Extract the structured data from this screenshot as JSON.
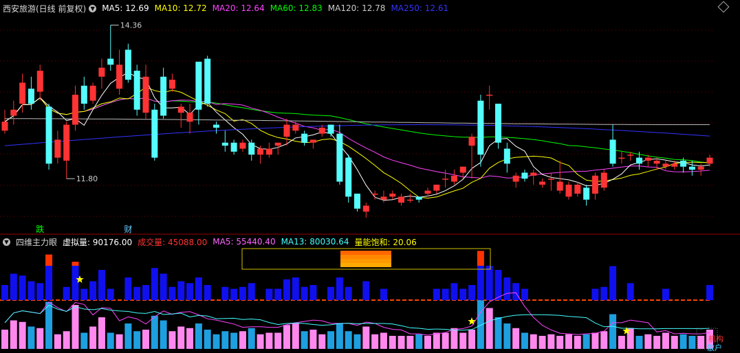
{
  "top": {
    "title": "西安旅游(日线 前复权)",
    "ma": [
      {
        "label": "MA5: 12.69",
        "color": "#ffffff"
      },
      {
        "label": "MA10: 12.72",
        "color": "#ffff00"
      },
      {
        "label": "MA20: 12.64",
        "color": "#ff44ff"
      },
      {
        "label": "MA60: 12.83",
        "color": "#00ff00"
      },
      {
        "label": "MA120: 12.78",
        "color": "#cccccc"
      },
      {
        "label": "MA250: 12.61",
        "color": "#3333ff"
      }
    ],
    "high_label": "14.36",
    "low_label": "11.80",
    "tag_fall": "跌",
    "tag_cai": "财"
  },
  "bottom": {
    "title": "四维主力眼",
    "items": [
      {
        "label": "虚拟量: 90176.00",
        "color": "#ffffff"
      },
      {
        "label": "成交量: 45088.00",
        "color": "#ff3333"
      },
      {
        "label": "MA5: 55440.40",
        "color": "#ff66ff"
      },
      {
        "label": "MA13: 80030.64",
        "color": "#44ffff"
      },
      {
        "label": "量能饱和: 20.06",
        "color": "#ffff00"
      }
    ],
    "corner1": "机构",
    "corner2": "散户"
  },
  "chart_data": [
    {
      "type": "candlestick",
      "title": "西安旅游(日线 前复权)",
      "high_marker": 14.36,
      "low_marker": 11.8,
      "ohlc": [
        [
          12.6,
          12.95,
          12.55,
          12.75
        ],
        [
          12.85,
          13.1,
          12.7,
          12.95
        ],
        [
          13.05,
          13.55,
          12.9,
          13.4
        ],
        [
          13.3,
          13.5,
          12.95,
          13.05
        ],
        [
          13.25,
          13.7,
          13.1,
          13.6
        ],
        [
          13.0,
          13.05,
          11.95,
          12.05
        ],
        [
          12.15,
          12.6,
          12.05,
          12.45
        ],
        [
          12.1,
          12.75,
          11.8,
          12.7
        ],
        [
          12.7,
          13.35,
          12.6,
          13.2
        ],
        [
          13.35,
          13.5,
          12.95,
          13.05
        ],
        [
          13.1,
          13.4,
          13.05,
          13.35
        ],
        [
          13.5,
          13.8,
          13.3,
          13.65
        ],
        [
          13.8,
          14.36,
          13.6,
          13.7
        ],
        [
          13.3,
          13.95,
          13.2,
          13.7
        ],
        [
          13.95,
          14.05,
          13.4,
          13.45
        ],
        [
          13.6,
          13.7,
          12.85,
          12.95
        ],
        [
          12.9,
          13.7,
          12.8,
          13.5
        ],
        [
          12.95,
          13.05,
          12.1,
          12.15
        ],
        [
          13.5,
          13.65,
          12.8,
          12.85
        ],
        [
          13.3,
          13.55,
          13.25,
          13.45
        ],
        [
          12.9,
          13.05,
          12.65,
          13.0
        ],
        [
          12.75,
          13.05,
          12.55,
          12.9
        ],
        [
          13.75,
          13.75,
          12.7,
          12.95
        ],
        [
          13.8,
          13.85,
          13.0,
          13.05
        ],
        [
          12.7,
          12.75,
          12.55,
          12.65
        ],
        [
          12.4,
          12.6,
          12.25,
          12.35
        ],
        [
          12.4,
          12.45,
          12.2,
          12.25
        ],
        [
          12.3,
          12.45,
          12.25,
          12.4
        ],
        [
          12.4,
          12.45,
          12.1,
          12.2
        ],
        [
          12.2,
          12.35,
          12.05,
          12.3
        ],
        [
          12.2,
          12.4,
          12.15,
          12.3
        ],
        [
          12.35,
          12.4,
          12.2,
          12.4
        ],
        [
          12.5,
          12.8,
          12.35,
          12.7
        ],
        [
          12.6,
          12.75,
          12.55,
          12.7
        ],
        [
          12.55,
          12.6,
          12.35,
          12.4
        ],
        [
          12.4,
          12.45,
          12.3,
          12.45
        ],
        [
          12.55,
          12.7,
          12.5,
          12.65
        ],
        [
          12.7,
          12.7,
          12.5,
          12.55
        ],
        [
          12.55,
          12.7,
          11.7,
          11.75
        ],
        [
          12.15,
          12.2,
          11.4,
          11.5
        ],
        [
          11.55,
          11.55,
          11.25,
          11.3
        ],
        [
          11.25,
          11.4,
          11.15,
          11.35
        ],
        [
          11.55,
          11.6,
          11.45,
          11.55
        ],
        [
          11.45,
          11.6,
          11.4,
          11.5
        ],
        [
          11.5,
          11.6,
          11.45,
          11.55
        ],
        [
          11.4,
          11.55,
          11.35,
          11.5
        ],
        [
          11.45,
          11.55,
          11.4,
          11.45
        ],
        [
          11.5,
          11.5,
          11.4,
          11.45
        ],
        [
          11.55,
          11.65,
          11.5,
          11.6
        ],
        [
          11.6,
          11.7,
          11.55,
          11.7
        ],
        [
          11.8,
          11.95,
          11.65,
          11.8
        ],
        [
          11.75,
          11.95,
          11.7,
          11.85
        ],
        [
          11.9,
          12.0,
          11.8,
          12.0
        ],
        [
          12.35,
          12.55,
          11.8,
          12.5
        ],
        [
          13.1,
          13.2,
          12.0,
          12.2
        ],
        [
          13.2,
          13.35,
          12.95,
          13.2
        ],
        [
          13.05,
          13.05,
          12.3,
          12.4
        ],
        [
          12.3,
          12.4,
          11.9,
          12.05
        ],
        [
          11.75,
          11.9,
          11.65,
          11.85
        ],
        [
          11.9,
          11.95,
          11.75,
          11.8
        ],
        [
          11.85,
          11.95,
          11.7,
          11.9
        ],
        [
          11.7,
          11.8,
          11.65,
          11.75
        ],
        [
          11.8,
          11.9,
          11.6,
          11.8
        ],
        [
          11.6,
          12.1,
          11.55,
          11.75
        ],
        [
          11.5,
          11.75,
          11.45,
          11.7
        ],
        [
          11.55,
          11.75,
          11.5,
          11.7
        ],
        [
          11.65,
          11.7,
          11.35,
          11.45
        ],
        [
          11.55,
          11.9,
          11.45,
          11.85
        ],
        [
          11.65,
          11.95,
          11.6,
          11.9
        ],
        [
          12.45,
          12.7,
          12.0,
          12.05
        ],
        [
          12.15,
          12.25,
          12.05,
          12.15
        ],
        [
          12.2,
          12.25,
          12.1,
          12.2
        ],
        [
          12.15,
          12.25,
          11.95,
          12.05
        ],
        [
          12.1,
          12.2,
          12.0,
          12.15
        ],
        [
          12.05,
          12.15,
          11.95,
          12.1
        ],
        [
          12.0,
          12.1,
          11.95,
          12.05
        ],
        [
          12.0,
          12.1,
          11.95,
          12.05
        ],
        [
          12.1,
          12.15,
          11.9,
          12.0
        ],
        [
          12.0,
          12.1,
          11.85,
          11.95
        ],
        [
          11.95,
          12.05,
          11.85,
          12.0
        ],
        [
          12.05,
          12.2,
          12.0,
          12.15
        ]
      ]
    },
    {
      "type": "bar",
      "title": "四维主力眼",
      "series": [
        {
          "name": "成交量",
          "values": [
            40,
            70,
            65,
            50,
            45,
            130,
            25,
            35,
            120,
            30,
            50,
            80,
            30,
            25,
            60,
            35,
            40,
            85,
            70,
            35,
            50,
            45,
            60,
            40,
            25,
            35,
            30,
            35,
            45,
            25,
            30,
            30,
            55,
            60,
            35,
            40,
            25,
            35,
            60,
            35,
            25,
            50,
            25,
            30,
            20,
            20,
            20,
            25,
            20,
            30,
            30,
            45,
            30,
            40,
            135,
            110,
            80,
            60,
            45,
            30,
            25,
            20,
            25,
            20,
            25,
            20,
            25,
            30,
            35,
            90,
            20,
            45,
            20,
            25,
            20,
            30,
            20,
            25,
            20,
            20,
            40
          ]
        }
      ]
    }
  ]
}
